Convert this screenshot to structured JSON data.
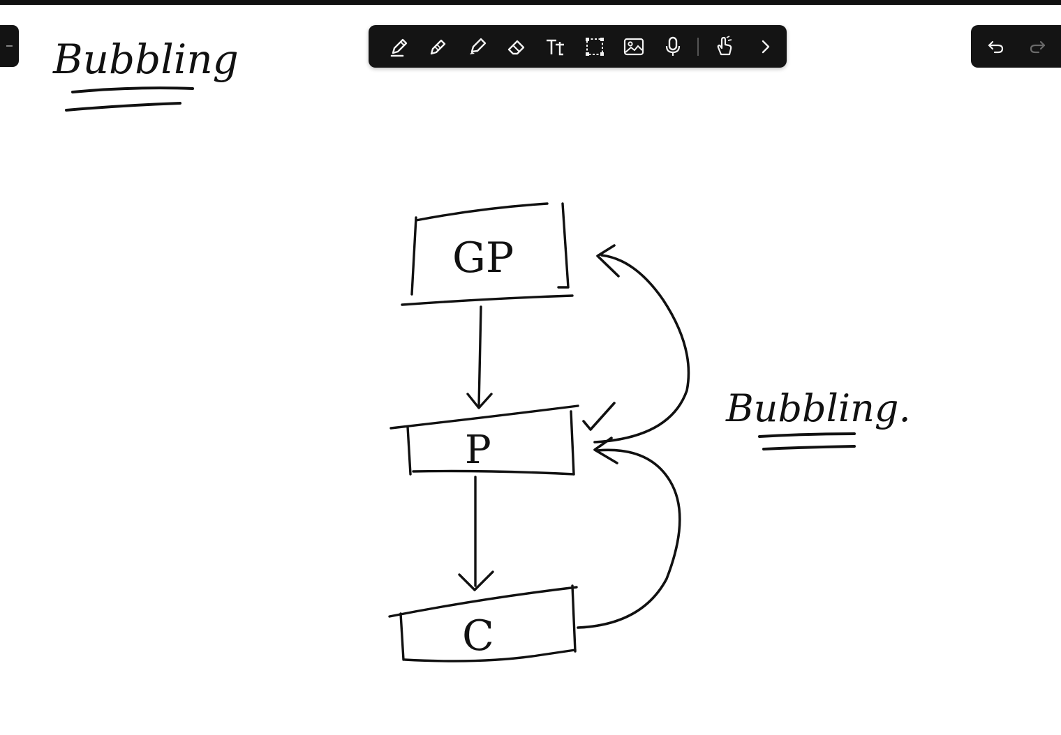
{
  "toolbar": {
    "tools": [
      {
        "name": "pen"
      },
      {
        "name": "pencil"
      },
      {
        "name": "highlighter"
      },
      {
        "name": "eraser"
      },
      {
        "name": "text"
      },
      {
        "name": "lasso-select"
      },
      {
        "name": "image"
      },
      {
        "name": "microphone"
      },
      {
        "name": "touch"
      },
      {
        "name": "more"
      }
    ]
  },
  "history": {
    "undo": "undo",
    "redo": "redo"
  },
  "board": {
    "title": "Bubbling",
    "side_label": "Bubbling.",
    "nodes": {
      "grandparent": "GP",
      "parent": "P",
      "child": "C"
    }
  },
  "colors": {
    "ink": "#111111",
    "toolbar_bg": "#141414",
    "toolbar_icon": "#f2f2f2",
    "canvas": "#ffffff"
  }
}
